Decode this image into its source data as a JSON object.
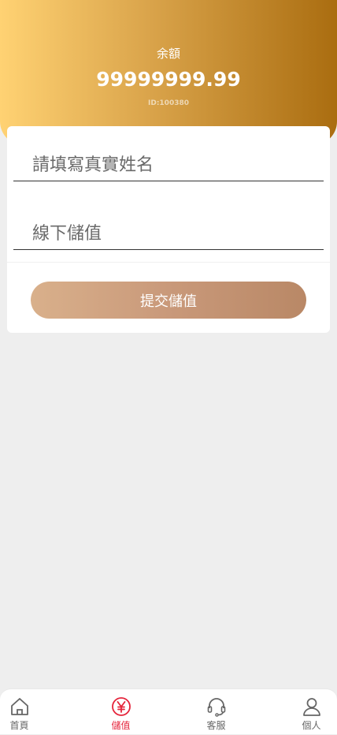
{
  "header": {
    "balance_label": "余額",
    "balance_amount": "99999999.99",
    "user_id": "ID:100380"
  },
  "form": {
    "name_placeholder": "請填寫真實姓名",
    "amount_placeholder": "線下儲值",
    "submit_label": "提交儲值"
  },
  "tabbar": {
    "items": [
      {
        "label": "首頁",
        "icon": "home-icon"
      },
      {
        "label": "儲值",
        "icon": "yen-icon",
        "active": true
      },
      {
        "label": "客服",
        "icon": "headset-icon"
      },
      {
        "label": "個人",
        "icon": "user-icon"
      }
    ]
  },
  "colors": {
    "accent": "#e5243b",
    "header_gradient_start": "#ffd273",
    "header_gradient_end": "#aa6d10",
    "button_gradient_start": "#d9b08b",
    "button_gradient_end": "#b98866"
  }
}
